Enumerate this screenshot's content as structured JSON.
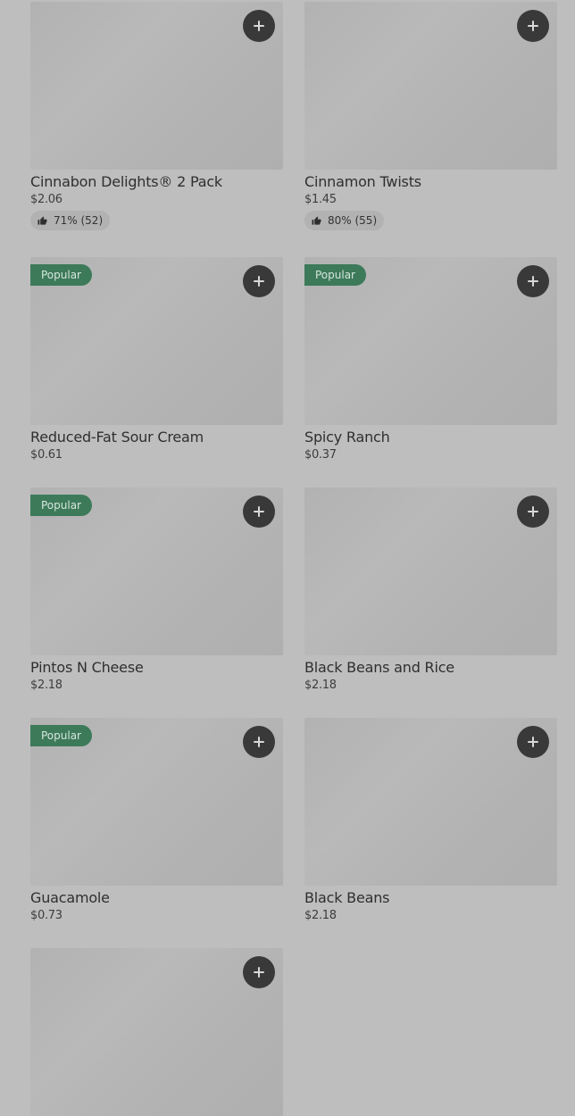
{
  "items": [
    {
      "name": "Cinnabon Delights® 2 Pack",
      "price": "$2.06",
      "badge": "",
      "rating": "71% (52)"
    },
    {
      "name": "Cinnamon Twists",
      "price": "$1.45",
      "badge": "",
      "rating": "80% (55)"
    },
    {
      "name": "Reduced-Fat Sour Cream",
      "price": "$0.61",
      "badge": "Popular",
      "rating": ""
    },
    {
      "name": "Spicy Ranch",
      "price": "$0.37",
      "badge": "Popular",
      "rating": ""
    },
    {
      "name": "Pintos N Cheese",
      "price": "$2.18",
      "badge": "Popular",
      "rating": ""
    },
    {
      "name": "Black Beans and Rice",
      "price": "$2.18",
      "badge": "",
      "rating": ""
    },
    {
      "name": "Guacamole",
      "price": "$0.73",
      "badge": "Popular",
      "rating": ""
    },
    {
      "name": "Black Beans",
      "price": "$2.18",
      "badge": "",
      "rating": ""
    },
    {
      "name": "",
      "price": "",
      "badge": "",
      "rating": ""
    }
  ],
  "icons": {
    "add": "plus-icon",
    "rating": "thumbs-up-icon"
  },
  "colors": {
    "background": "#bebebe",
    "badge": "#3d7a5a",
    "add_button": "#393939"
  }
}
